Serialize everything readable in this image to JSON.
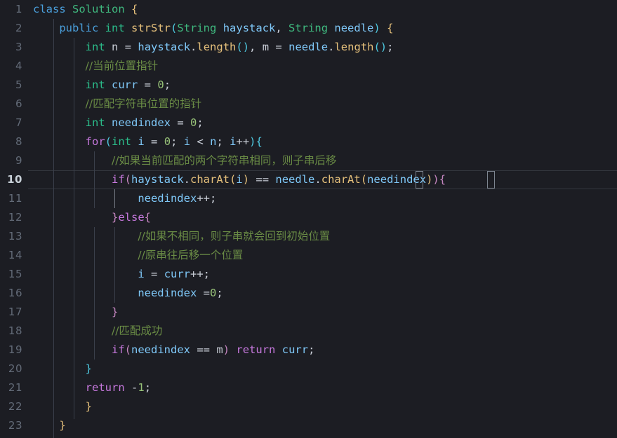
{
  "editor": {
    "language": "java",
    "theme": "dark",
    "active_line": 10,
    "total_lines": 23,
    "line_height_px": 27,
    "colors": {
      "background": "#1c1d23",
      "gutter_text": "#636b78",
      "active_gutter_text": "#c9d1d9",
      "comment": "#6a8c45",
      "keyword": "#c678dd",
      "keyword_blue": "#4a9eda",
      "type": "#2bbc8a",
      "class": "#3fb97f",
      "function": "#e5c07b",
      "variable": "#7fc8f8",
      "number": "#98c379",
      "bracket_1": "#e5c07b",
      "bracket_2": "#4ec9e0",
      "bracket_3": "#c586c0",
      "indent_guide": "#3a3f4b",
      "active_indent_guide": "#767b85",
      "bracket_match_border": "#7d8590"
    }
  },
  "line_numbers": [
    "1",
    "2",
    "3",
    "4",
    "5",
    "6",
    "7",
    "8",
    "9",
    "10",
    "11",
    "12",
    "13",
    "14",
    "15",
    "16",
    "17",
    "18",
    "19",
    "20",
    "21",
    "22",
    "23"
  ],
  "code_lines": [
    {
      "n": 1,
      "indent": 0,
      "text": "class Solution {"
    },
    {
      "n": 2,
      "indent": 1,
      "text": "public int strStr(String haystack, String needle) {"
    },
    {
      "n": 3,
      "indent": 2,
      "text": "int n = haystack.length(), m = needle.length();"
    },
    {
      "n": 4,
      "indent": 2,
      "text": "//当前位置指针"
    },
    {
      "n": 5,
      "indent": 2,
      "text": "int curr = 0;"
    },
    {
      "n": 6,
      "indent": 2,
      "text": "//匹配字符串位置的指针"
    },
    {
      "n": 7,
      "indent": 2,
      "text": "int needindex = 0;"
    },
    {
      "n": 8,
      "indent": 2,
      "text": "for(int i = 0; i < n; i++){"
    },
    {
      "n": 9,
      "indent": 3,
      "text": "//如果当前匹配的两个字符串相同，则子串后移"
    },
    {
      "n": 10,
      "indent": 3,
      "text": "if(haystack.charAt(i) == needle.charAt(needindex)){"
    },
    {
      "n": 11,
      "indent": 4,
      "text": "needindex++;"
    },
    {
      "n": 12,
      "indent": 3,
      "text": "}else{"
    },
    {
      "n": 13,
      "indent": 4,
      "text": "//如果不相同，则子串就会回到初始位置"
    },
    {
      "n": 14,
      "indent": 4,
      "text": "//原串往后移一个位置"
    },
    {
      "n": 15,
      "indent": 4,
      "text": "i = curr++;"
    },
    {
      "n": 16,
      "indent": 4,
      "text": "needindex =0;"
    },
    {
      "n": 17,
      "indent": 3,
      "text": "}"
    },
    {
      "n": 18,
      "indent": 3,
      "text": "//匹配成功"
    },
    {
      "n": 19,
      "indent": 3,
      "text": "if(needindex == m) return curr;"
    },
    {
      "n": 20,
      "indent": 2,
      "text": "}"
    },
    {
      "n": 21,
      "indent": 2,
      "text": "return -1;"
    },
    {
      "n": 22,
      "indent": 2,
      "text": "}"
    },
    {
      "n": 23,
      "indent": 1,
      "text": "}"
    }
  ],
  "bracket_match": {
    "line": 10,
    "open_char": "(",
    "close_char": ")",
    "description": "matched parenthesis pair around needindex"
  }
}
